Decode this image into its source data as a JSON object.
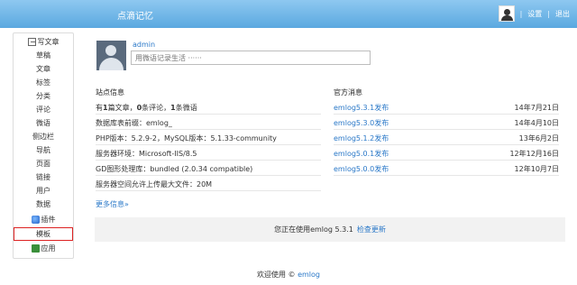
{
  "header": {
    "site_title": "点滴记忆",
    "separator": "|",
    "settings": "设置",
    "logout": "退出"
  },
  "sidebar": {
    "items": [
      {
        "label": "写文章",
        "icon": "write-icon"
      },
      {
        "label": "草稿"
      },
      {
        "label": "文章"
      },
      {
        "label": "标签"
      },
      {
        "label": "分类"
      },
      {
        "label": "评论"
      },
      {
        "label": "微语"
      },
      {
        "label": "侧边栏"
      },
      {
        "label": "导航"
      },
      {
        "label": "页面"
      },
      {
        "label": "链接"
      },
      {
        "label": "用户"
      },
      {
        "label": "数据"
      },
      {
        "label": "插件",
        "icon": "plugin-icon"
      },
      {
        "label": "模板",
        "highlighted": true
      },
      {
        "label": "应用",
        "icon": "app-icon"
      }
    ]
  },
  "profile": {
    "username": "admin",
    "status_placeholder": "用微语记录生活 ······"
  },
  "site_info": {
    "title": "站点信息",
    "stats_has": "有",
    "articles_count": "1",
    "articles_label": "篇文章，",
    "comments_count": "0",
    "comments_label": "条评论，",
    "twitter_count": "1",
    "twitter_label": "条微语",
    "db_prefix": "数据库表前缀：emlog_",
    "php_version": "PHP版本：5.2.9-2，MySQL版本：5.1.33-community",
    "server_env": "服务器环境：Microsoft-IIS/8.5",
    "gd_lib": "GD图形处理库：bundled (2.0.34 compatible)",
    "upload_limit": "服务器空间允许上传最大文件：20M",
    "more": "更多信息»"
  },
  "official_news": {
    "title": "官方消息",
    "items": [
      {
        "title": "emlog5.3.1发布",
        "date": "14年7月21日"
      },
      {
        "title": "emlog5.3.0发布",
        "date": "14年4月10日"
      },
      {
        "title": "emlog5.1.2发布",
        "date": "13年6月2日"
      },
      {
        "title": "emlog5.0.1发布",
        "date": "12年12月16日"
      },
      {
        "title": "emlog5.0.0发布",
        "date": "12年10月7日"
      }
    ]
  },
  "version_bar": {
    "text": "您正在使用emlog 5.3.1",
    "check_update": "检查更新"
  },
  "footer": {
    "prefix": "欢迎使用 ©",
    "brand": "emlog"
  },
  "colors": {
    "header_blue": "#5aa8e0",
    "link_blue": "#2a78c8",
    "highlight_red": "#dd2222"
  }
}
